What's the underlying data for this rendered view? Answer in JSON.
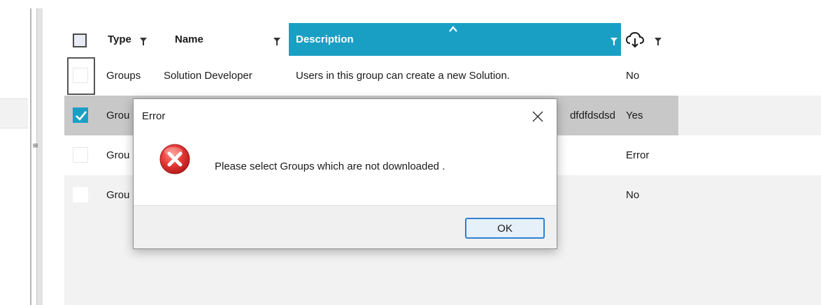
{
  "grid": {
    "columns": [
      {
        "label": "Type"
      },
      {
        "label": "Name"
      },
      {
        "label": "Description"
      },
      {
        "label": ""
      }
    ],
    "sort_column": "Description",
    "download_icon": "cloud-download-icon",
    "rows": [
      {
        "type": "Groups",
        "name": "Solution Developer",
        "description": "Users in this group can create a new Solution.",
        "downloaded": "No",
        "checked": false
      },
      {
        "type": "Grou",
        "name": "",
        "description": "dfdfdsdsd",
        "downloaded": "Yes",
        "checked": true
      },
      {
        "type": "Grou",
        "name": "",
        "description": "",
        "downloaded": "Error",
        "checked": false
      },
      {
        "type": "Grou",
        "name": "",
        "description": "",
        "downloaded": "No",
        "checked": false
      }
    ],
    "accent_color": "#1a9fc4"
  },
  "dialog": {
    "title": "Error",
    "icon": "error-icon",
    "message": "Please select Groups which are not downloaded .",
    "ok_label": "OK"
  }
}
